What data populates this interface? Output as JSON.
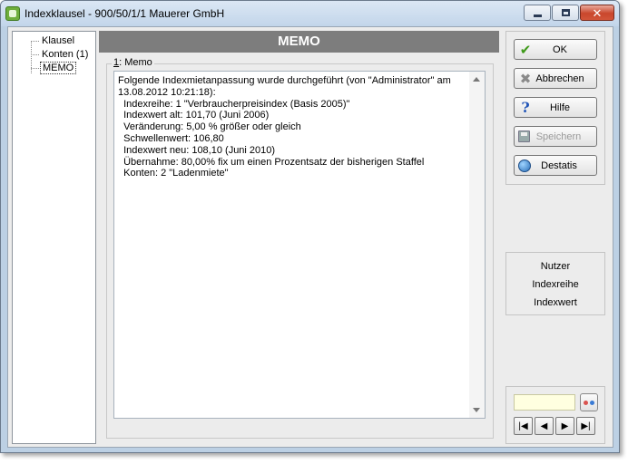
{
  "window": {
    "title": "Indexklausel - 900/50/1/1 Mauerer GmbH",
    "controls": {
      "minimize": "minimize-icon",
      "maximize": "maximize-icon",
      "close": "close-icon"
    }
  },
  "tree": {
    "items": [
      {
        "label": "Klausel",
        "selected": false
      },
      {
        "label": "Konten (1)",
        "selected": false
      },
      {
        "label": "MEMO",
        "selected": true
      }
    ]
  },
  "main": {
    "header": "MEMO",
    "memo_label_hotkey": "1",
    "memo_label": ": Memo",
    "memo_lines": [
      "Folgende Indexmietanpassung wurde durchgeführt (von \"Administrator\" am",
      "13.08.2012 10:21:18):",
      "  Indexreihe: 1 \"Verbraucherpreisindex (Basis 2005)\"",
      "  Indexwert alt: 101,70 (Juni 2006)",
      "  Veränderung: 5,00 % größer oder gleich",
      "  Schwellenwert: 106,80",
      "  Indexwert neu: 108,10 (Juni 2010)",
      "  Übernahme: 80,00% fix um einen Prozentsatz der bisherigen Staffel",
      "  Konten: 2 \"Ladenmiete\""
    ]
  },
  "actions": {
    "ok": "OK",
    "cancel": "Abbrechen",
    "help": "Hilfe",
    "save": "Speichern",
    "destatis": "Destatis"
  },
  "info": {
    "line1": "Nutzer",
    "line2": "Indexreihe",
    "line3": "Indexwert"
  },
  "nav": {
    "input_value": "",
    "first": "|◀",
    "prev": "◀",
    "next": "▶",
    "last": "▶|"
  },
  "colors": {
    "header_bg": "#7d7d7d",
    "ok_green": "#3f9a1a",
    "help_blue": "#2457b8",
    "nav_input_bg": "#ffffe0"
  }
}
